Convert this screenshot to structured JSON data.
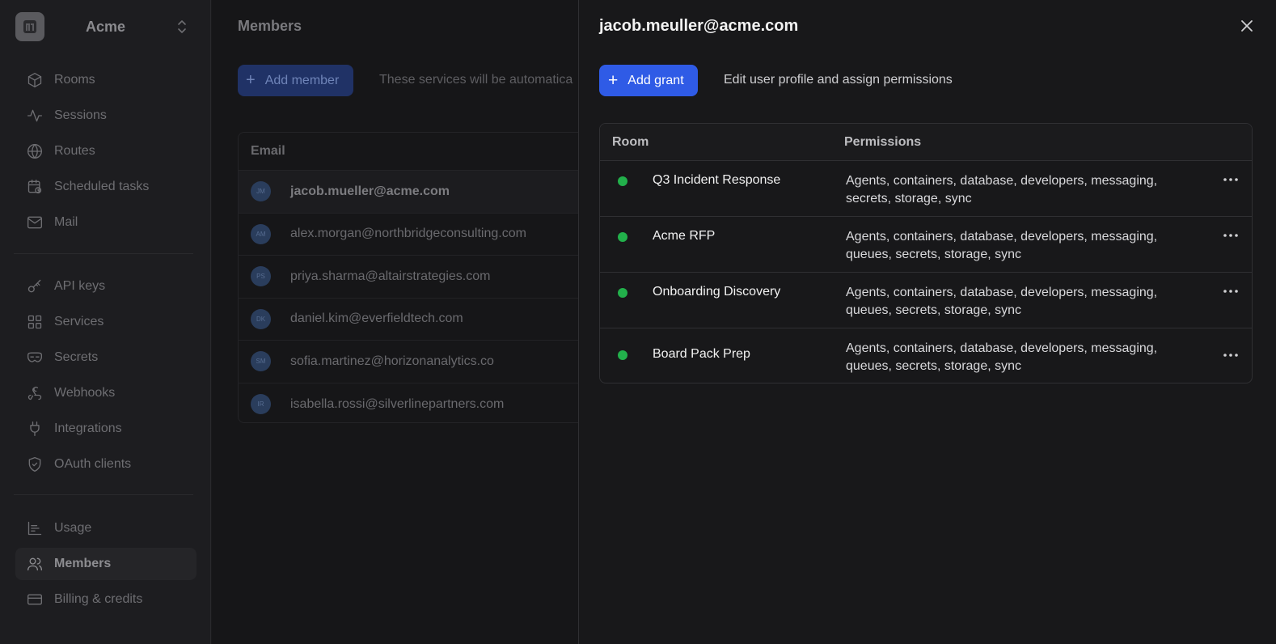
{
  "sidebar": {
    "org_name": "Acme",
    "items": [
      {
        "label": "Rooms",
        "icon": "cube-icon"
      },
      {
        "label": "Sessions",
        "icon": "activity-icon"
      },
      {
        "label": "Routes",
        "icon": "globe-icon"
      },
      {
        "label": "Scheduled tasks",
        "icon": "calendar-clock-icon"
      },
      {
        "label": "Mail",
        "icon": "mail-icon"
      },
      {
        "label": "API keys",
        "icon": "key-icon"
      },
      {
        "label": "Services",
        "icon": "grid-icon"
      },
      {
        "label": "Secrets",
        "icon": "mask-icon"
      },
      {
        "label": "Webhooks",
        "icon": "webhook-icon"
      },
      {
        "label": "Integrations",
        "icon": "plug-icon"
      },
      {
        "label": "OAuth clients",
        "icon": "shield-check-icon"
      },
      {
        "label": "Usage",
        "icon": "bar-chart-icon"
      },
      {
        "label": "Members",
        "icon": "users-icon",
        "active": true
      },
      {
        "label": "Billing & credits",
        "icon": "credit-card-icon"
      }
    ]
  },
  "main": {
    "title": "Members",
    "add_member_label": "Add member",
    "services_note": "These services will be automatica",
    "table_header": "Email",
    "members": [
      {
        "initials": "JM",
        "email": "jacob.mueller@acme.com"
      },
      {
        "initials": "AM",
        "email": "alex.morgan@northbridgeconsulting.com"
      },
      {
        "initials": "PS",
        "email": "priya.sharma@altairstrategies.com"
      },
      {
        "initials": "DK",
        "email": "daniel.kim@everfieldtech.com"
      },
      {
        "initials": "SM",
        "email": "sofia.martinez@horizonanalytics.co"
      },
      {
        "initials": "IR",
        "email": "isabella.rossi@silverlinepartners.com"
      }
    ]
  },
  "drawer": {
    "title": "jacob.meuller@acme.com",
    "add_grant_label": "Add grant",
    "note": "Edit user profile and assign permissions",
    "columns": {
      "room": "Room",
      "permissions": "Permissions"
    },
    "status_color": "#22b04b",
    "accent_color": "#2f5be6",
    "grants": [
      {
        "room": "Q3 Incident Response",
        "permissions": "Agents, containers, database, developers, messaging, secrets, storage, sync"
      },
      {
        "room": "Acme RFP",
        "permissions": "Agents, containers, database, developers, messaging, queues, secrets, storage, sync"
      },
      {
        "room": "Onboarding Discovery",
        "permissions": "Agents, containers, database, developers, messaging, queues, secrets, storage, sync"
      },
      {
        "room": "Board Pack Prep",
        "permissions": "Agents, containers, database, developers, messaging, queues, secrets, storage, sync"
      }
    ]
  }
}
